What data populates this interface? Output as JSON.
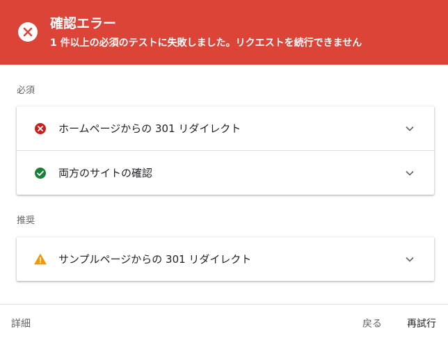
{
  "banner": {
    "icon": "error-x-icon",
    "title": "確認エラー",
    "message": "1 件以上の必須のテストに失敗しました。リクエストを続行できません",
    "color": "#db4437"
  },
  "sections": {
    "required": {
      "label": "必須",
      "items": [
        {
          "label": "ホームページからの 301 リダイレクト",
          "status": "error",
          "icon": "error-circle-icon",
          "color": "#c5221f"
        },
        {
          "label": "両方のサイトの確認",
          "status": "passed",
          "icon": "check-circle-icon",
          "color": "#188038"
        }
      ]
    },
    "recommended": {
      "label": "推奨",
      "items": [
        {
          "label": "サンプルページからの 301 リダイレクト",
          "status": "warning",
          "icon": "warning-triangle-icon",
          "color": "#f29900"
        }
      ]
    }
  },
  "footer": {
    "details_label": "詳細",
    "back_label": "戻る",
    "retry_label": "再試行"
  }
}
